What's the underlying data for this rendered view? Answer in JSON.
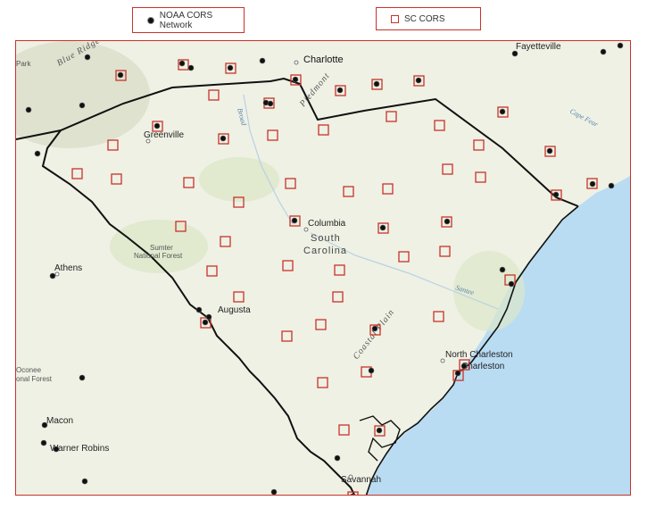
{
  "legend": {
    "noaa_label": "NOAA CORS Network",
    "sc_label": "SC CORS"
  },
  "colors": {
    "marker_red": "#c8322a",
    "dot_black": "#111111",
    "ocean": "#b9dcf3",
    "land": "#eef1e4",
    "border": "#111111"
  },
  "places": {
    "charlotte": "Charlotte",
    "fayetteville": "Fayetteville",
    "greenville": "Greenville",
    "columbia": "Columbia",
    "augusta": "Augusta",
    "athens": "Athens",
    "macon": "Macon",
    "warner_robins": "Warner Robins",
    "north_charleston": "North Charleston",
    "charleston": "Charleston",
    "savannah": "Savannah",
    "blue_ridge": "Blue Ridge",
    "park_fragment": "Park",
    "sumter_nf_1": "Sumter",
    "sumter_nf_2": "National Forest",
    "oconee_nf_1": "Oconee",
    "oconee_nf_2": "onal Forest",
    "piedmont": "Piedmont",
    "coastal_plain": "Coastal Plain",
    "state_line1": "South",
    "state_line2": "Carolina",
    "broad_river": "Broad",
    "santee_river": "Santee",
    "cape_fear": "Cape Fear"
  }
}
